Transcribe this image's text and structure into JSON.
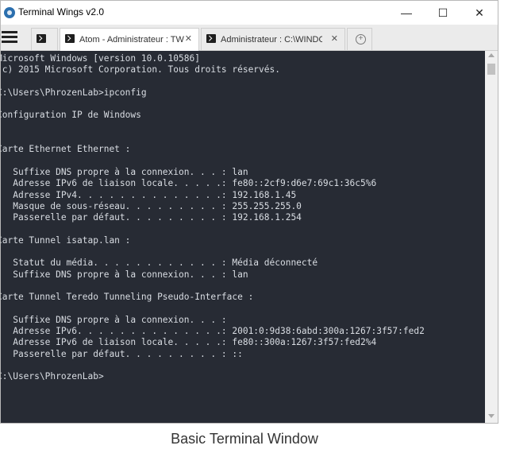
{
  "window": {
    "title": "Terminal Wings v2.0",
    "minimize_glyph": "—",
    "maximize_glyph": "☐",
    "close_glyph": "✕"
  },
  "tabs": [
    {
      "label": "",
      "icon": "powershell-icon"
    },
    {
      "label": "Atom - Administrateur : TW",
      "icon": "powershell-icon",
      "close": "✕",
      "active": true
    },
    {
      "label": "Administrateur : C:\\WINDO",
      "icon": "powershell-icon",
      "close": "✕"
    }
  ],
  "new_tab_glyph": "+",
  "terminal": {
    "text": "Microsoft Windows [version 10.0.10586]\n(c) 2015 Microsoft Corporation. Tous droits réservés.\n\nC:\\Users\\PhrozenLab>ipconfig\n\nConfiguration IP de Windows\n\n\nCarte Ethernet Ethernet :\n\n   Suffixe DNS propre à la connexion. . . : lan\n   Adresse IPv6 de liaison locale. . . . .: fe80::2cf9:d6e7:69c1:36c5%6\n   Adresse IPv4. . . . . . . . . . . . . .: 192.168.1.45\n   Masque de sous-réseau. . . . . . . . . : 255.255.255.0\n   Passerelle par défaut. . . . . . . . . : 192.168.1.254\n\nCarte Tunnel isatap.lan :\n\n   Statut du média. . . . . . . . . . . . : Média déconnecté\n   Suffixe DNS propre à la connexion. . . : lan\n\nCarte Tunnel Teredo Tunneling Pseudo-Interface :\n\n   Suffixe DNS propre à la connexion. . . :\n   Adresse IPv6. . . . . . . . . . . . . .: 2001:0:9d38:6abd:300a:1267:3f57:fed2\n   Adresse IPv6 de liaison locale. . . . .: fe80::300a:1267:3f57:fed2%4\n   Passerelle par défaut. . . . . . . . . : ::\n\nC:\\Users\\PhrozenLab>"
  },
  "caption": "Basic Terminal Window",
  "colors": {
    "terminal_bg": "#272b34",
    "terminal_fg": "#d9dde3"
  }
}
